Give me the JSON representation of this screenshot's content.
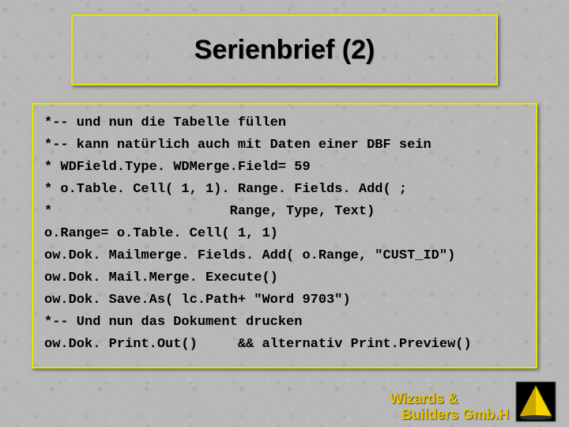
{
  "title": "Serienbrief (2)",
  "code_lines": [
    "*-- und nun die Tabelle füllen",
    "*-- kann natürlich auch mit Daten einer DBF sein",
    "* WDField.Type. WDMerge.Field= 59",
    "* o.Table. Cell( 1, 1). Range. Fields. Add( ;",
    "*                      Range, Type, Text)",
    "o.Range= o.Table. Cell( 1, 1)",
    "ow.Dok. Mailmerge. Fields. Add( o.Range, \"CUST_ID\")",
    "ow.Dok. Mail.Merge. Execute()",
    "ow.Dok. Save.As( lc.Path+ \"Word 9703\")",
    "*-- Und nun das Dokument drucken",
    "ow.Dok. Print.Out()     && alternativ Print.Preview()"
  ],
  "footer": {
    "line1": "Wizards &",
    "line2": "Builders Gmb.H"
  },
  "colors": {
    "accent_border": "#e6e600",
    "footer_text": "#e6c300"
  }
}
